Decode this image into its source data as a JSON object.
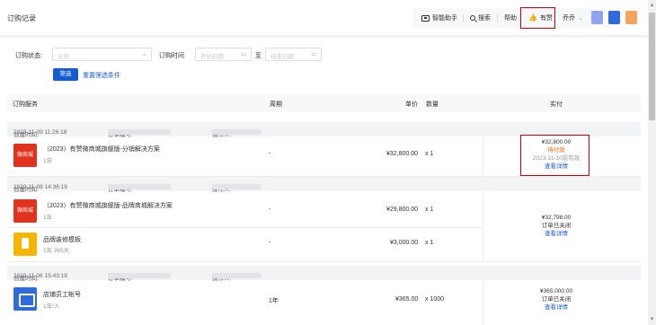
{
  "header": {
    "title": "订购记录",
    "ai_assistant": "智能助手",
    "search": "搜索",
    "help": "帮助",
    "youzan": "有赞",
    "user": "乔乔"
  },
  "filters": {
    "status_label": "订购状态:",
    "status_value": "全部",
    "time_label": "订购时间",
    "start_placeholder": "开始日期",
    "range_sep": "至",
    "end_placeholder": "结束日期",
    "filter_button": "筛选",
    "reset_link": "重置筛选条件"
  },
  "table": {
    "columns": [
      "订购服务",
      "周期",
      "单价",
      "数量",
      "实付"
    ]
  },
  "orders": [
    {
      "created_label": "创建时间:",
      "created_time": "2023-11-09 11:26:18",
      "order_no_label": "订单编号:",
      "operator_label": "操作人:",
      "items": [
        {
          "thumb_text": "微商城",
          "name": "（2023）有赞微商城旗舰版-分销解决方案",
          "sub": "1年",
          "period": "-",
          "price": "¥32,800.00",
          "qty": "x 1"
        }
      ],
      "amount": "¥32,800.00",
      "status": "待付款",
      "expiry": "2023-11-10前有效",
      "detail_link": "查看详情"
    },
    {
      "created_label": "创建时间:",
      "created_time": "2023-11-08 14:36:19",
      "order_no_label": "订单编号:",
      "operator_label": "操作人:",
      "items": [
        {
          "thumb_text": "微商城",
          "name": "（2023）有赞微商城旗舰版-品牌商城解决方案",
          "sub": "1年",
          "period": "-",
          "price": "¥29,800.00",
          "qty": "x 1"
        },
        {
          "thumb_text": "",
          "name": "品牌装修模板",
          "sub": "1年 365天",
          "period": "-",
          "price": "¥3,000.00",
          "qty": "x 1"
        }
      ],
      "amount": "¥32,798.00",
      "status": "订单已关闭",
      "detail_link": "查看详情"
    },
    {
      "created_label": "创建时间:",
      "created_time": "2023-11-06 15:43:19",
      "order_no_label": "订单编号:",
      "operator_label": "操作人:",
      "items": [
        {
          "thumb_text": "",
          "name": "店铺员工帐号",
          "sub": "1年/人",
          "period": "1年",
          "price": "¥365.00",
          "qty": "x 1000"
        }
      ],
      "amount": "¥365,000.00",
      "status": "订单已关闭",
      "detail_link": "查看详情"
    }
  ],
  "colors": {
    "primary": "#155bd4",
    "pending": "#ed6a0c",
    "highlight": "#d40000"
  }
}
